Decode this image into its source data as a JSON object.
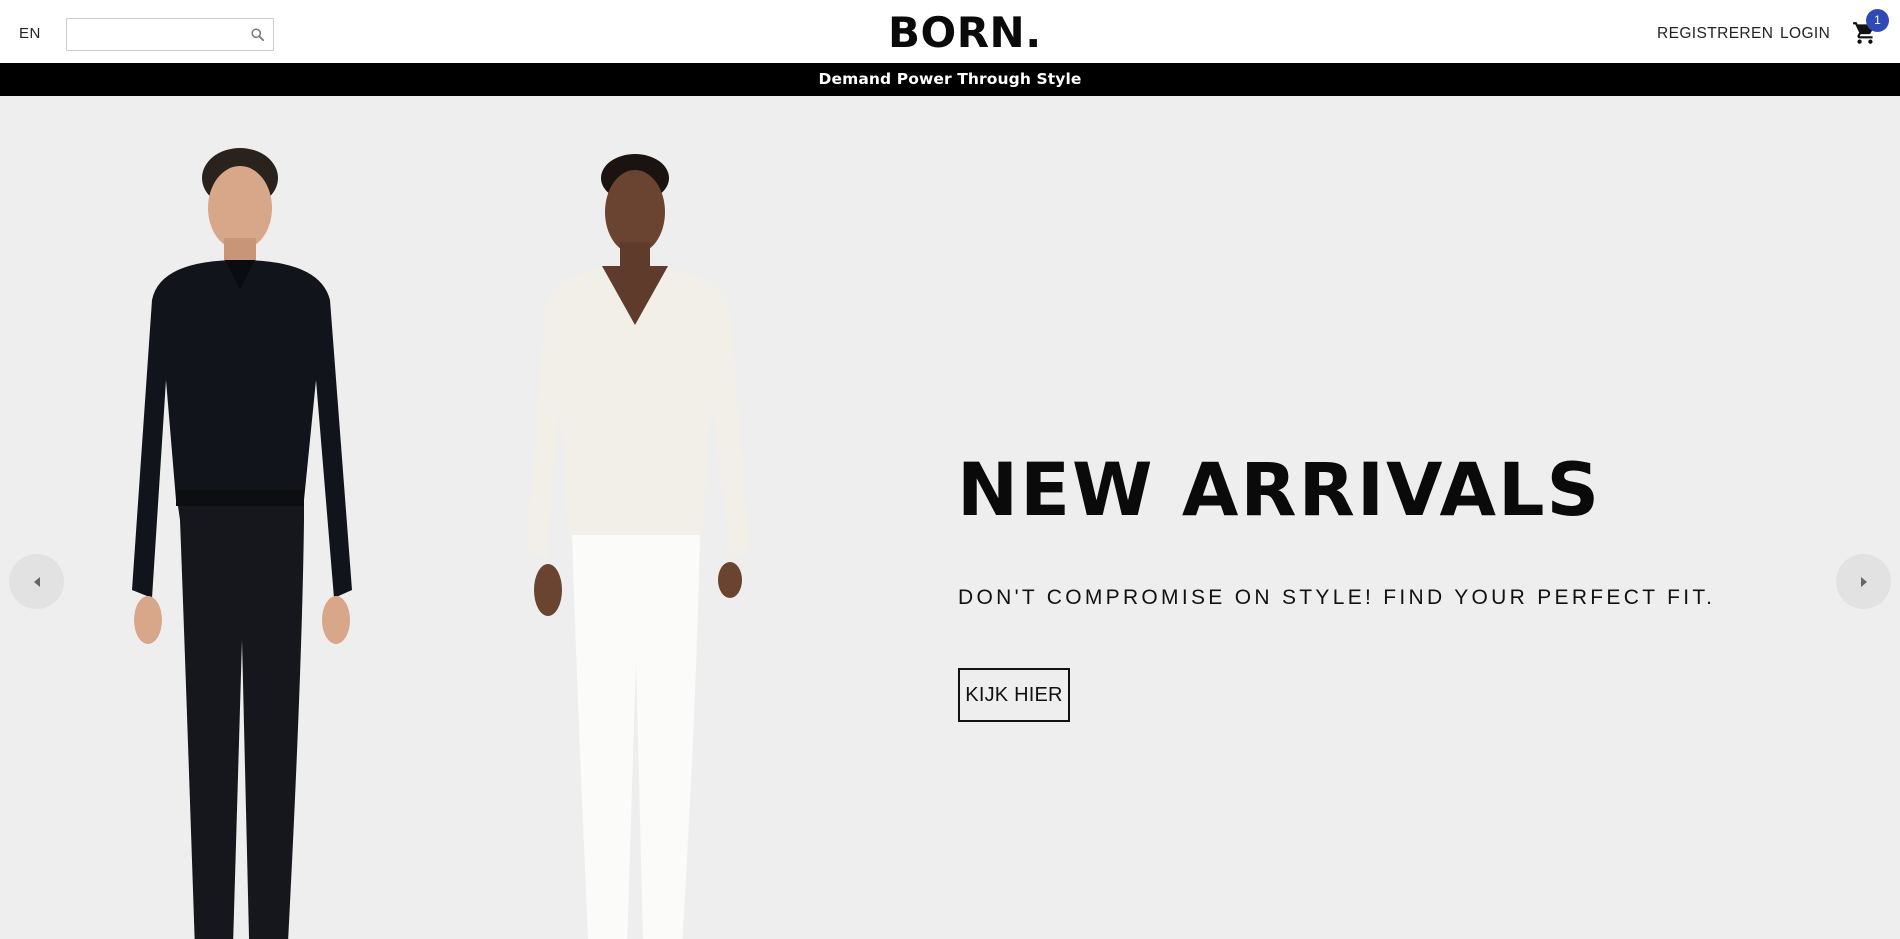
{
  "header": {
    "language": "EN",
    "search": {
      "value": "",
      "placeholder": ""
    },
    "logo": "BORN.",
    "register_label": "REGISTREREN",
    "login_label": "LOGIN",
    "cart_count": "1",
    "cart_icon": "cart-icon",
    "search_icon": "search-icon"
  },
  "announcement": {
    "text": "Demand Power Through Style"
  },
  "hero": {
    "title": "NEW ARRIVALS",
    "subtitle": "DON'T COMPROMISE ON STYLE! FIND YOUR PERFECT FIT.",
    "cta_label": "KIJK HIER",
    "prev_icon": "chevron-left-icon",
    "next_icon": "chevron-right-icon"
  },
  "colors": {
    "announcement_bg": "#000000",
    "hero_bg": "#eeeeee",
    "cart_badge": "#2f4ab5"
  }
}
